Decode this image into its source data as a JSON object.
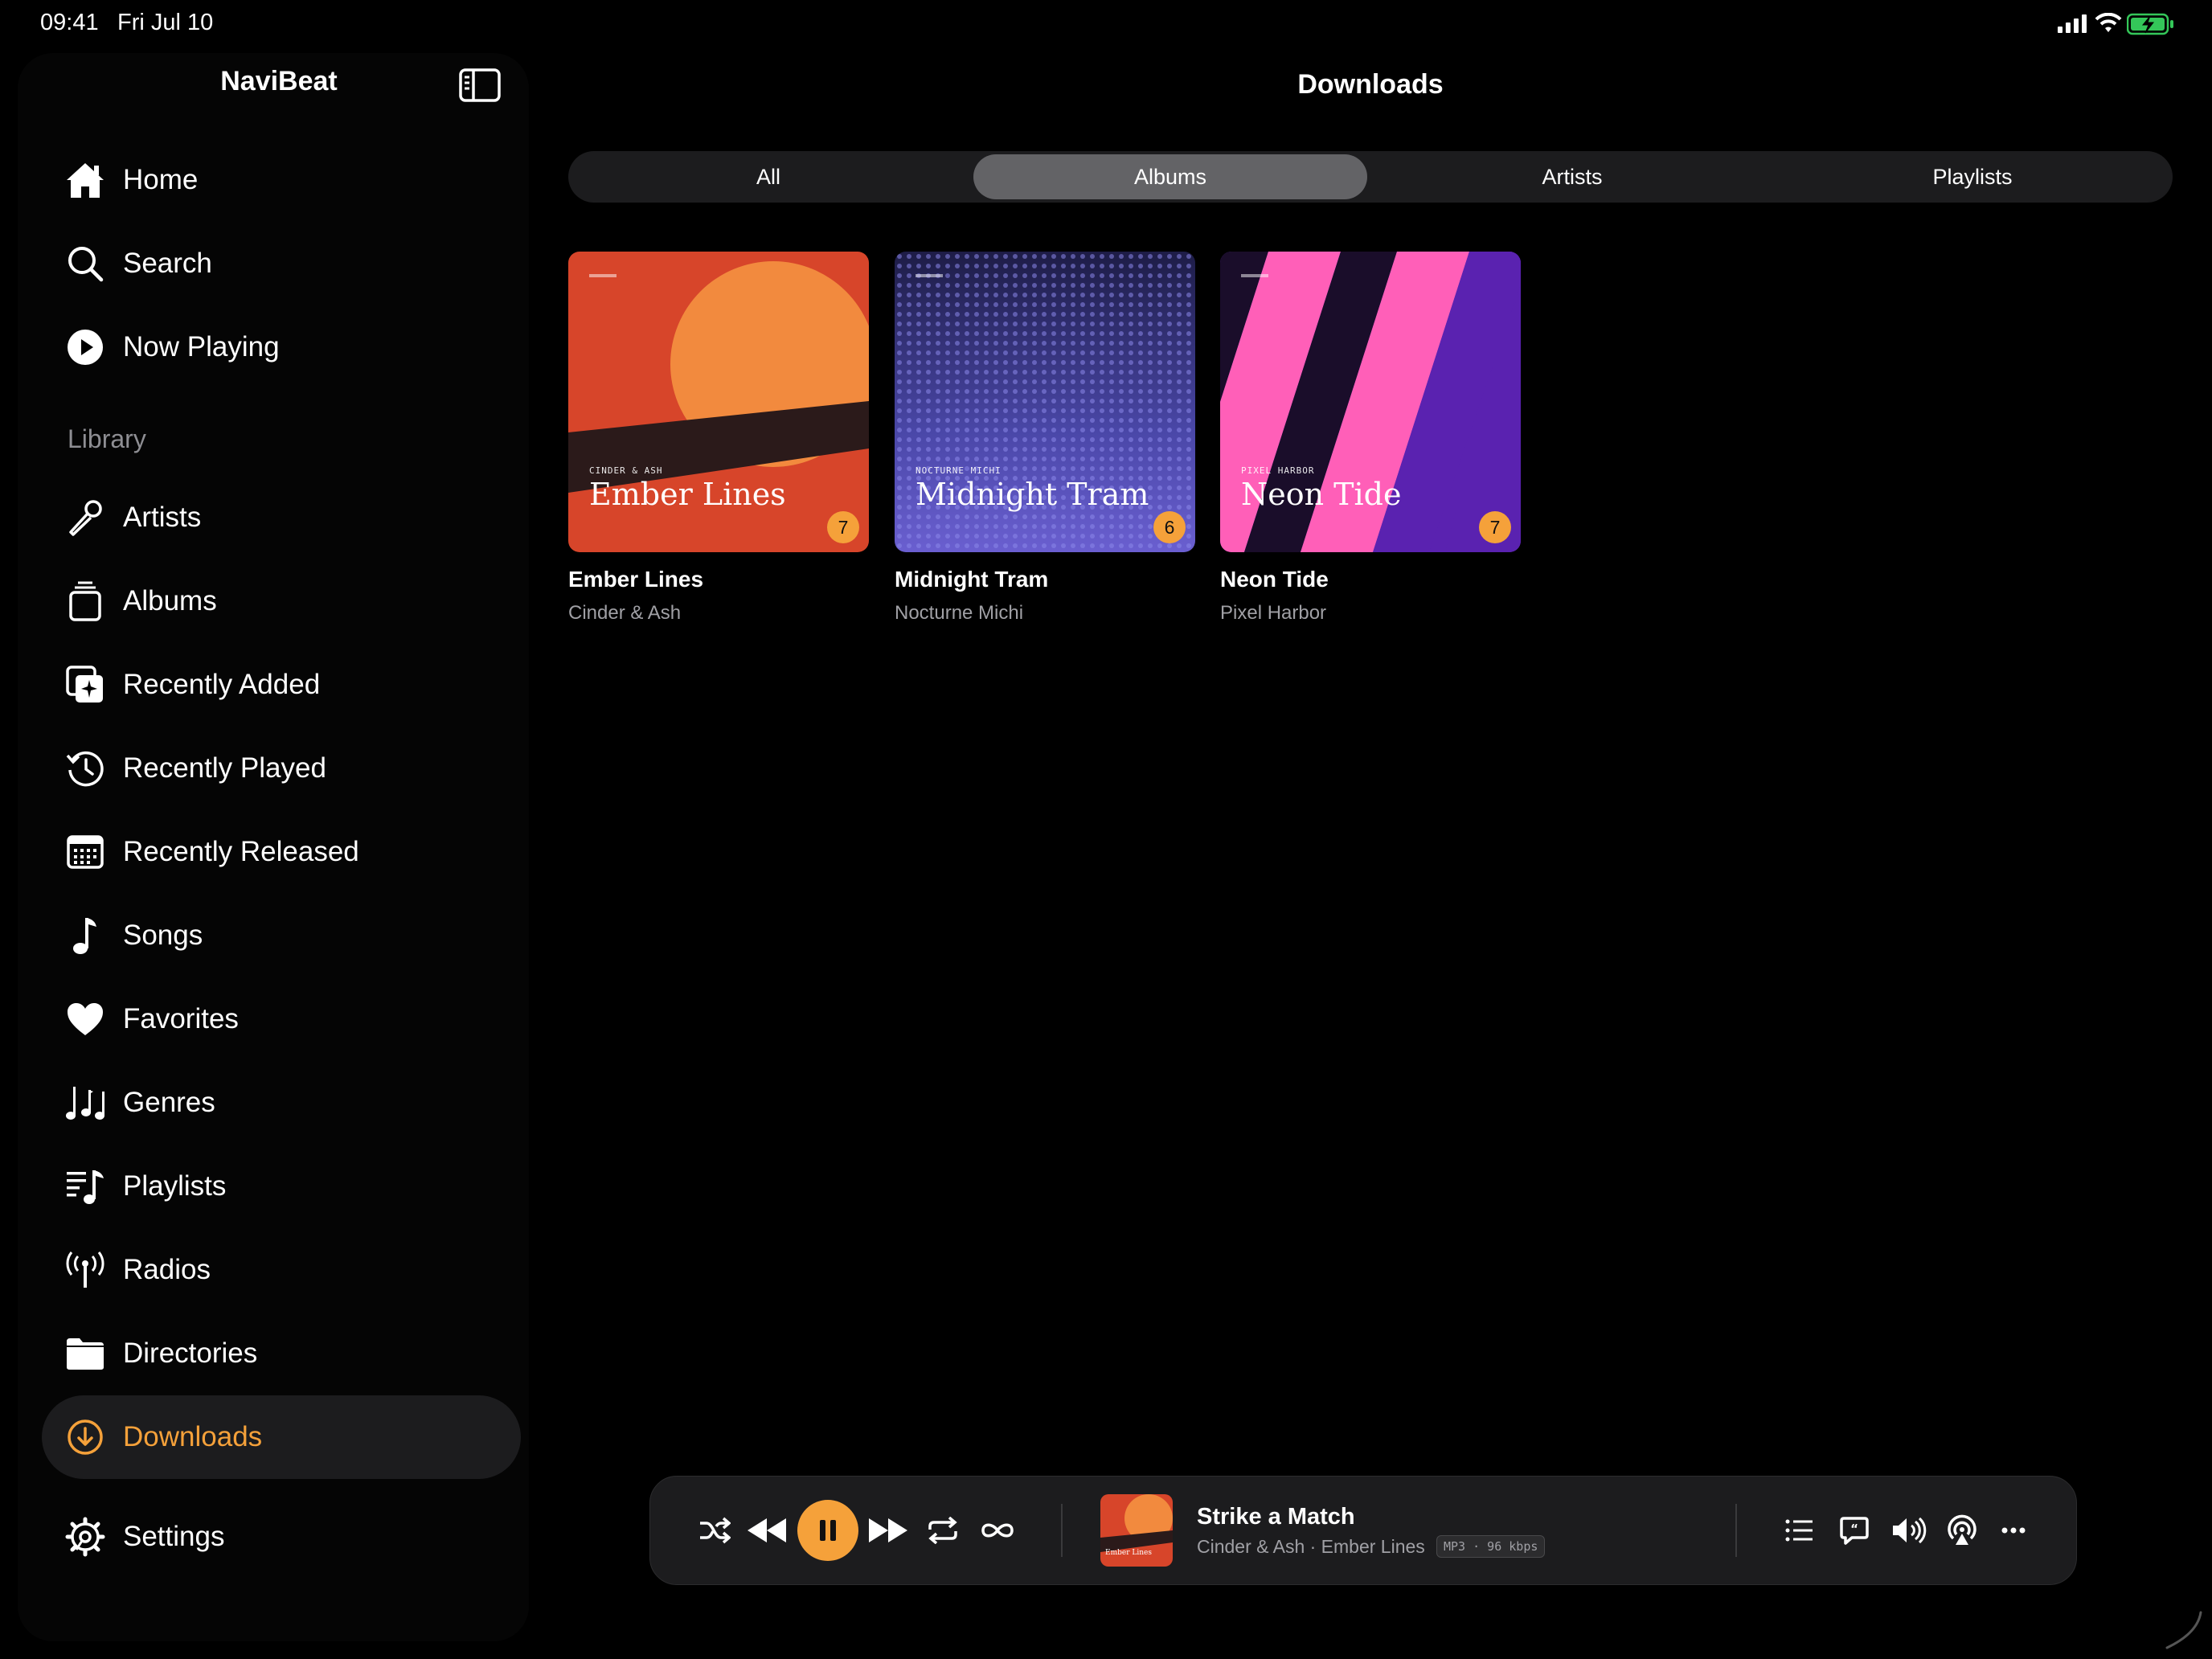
{
  "status": {
    "time": "09:41",
    "date": "Fri Jul 10"
  },
  "sidebar": {
    "app_title": "NaviBeat",
    "section_library": "Library",
    "items": [
      {
        "key": "home",
        "label": "Home",
        "icon": "house-icon"
      },
      {
        "key": "search",
        "label": "Search",
        "icon": "magnifier-icon"
      },
      {
        "key": "now-playing",
        "label": "Now Playing",
        "icon": "play-circle-icon"
      },
      {
        "key": "artists",
        "label": "Artists",
        "icon": "microphone-icon"
      },
      {
        "key": "albums",
        "label": "Albums",
        "icon": "album-stack-icon"
      },
      {
        "key": "recently-added",
        "label": "Recently Added",
        "icon": "add-star-icon"
      },
      {
        "key": "recently-played",
        "label": "Recently Played",
        "icon": "history-clock-icon"
      },
      {
        "key": "recently-released",
        "label": "Recently Released",
        "icon": "calendar-icon"
      },
      {
        "key": "songs",
        "label": "Songs",
        "icon": "music-note-icon"
      },
      {
        "key": "favorites",
        "label": "Favorites",
        "icon": "heart-icon"
      },
      {
        "key": "genres",
        "label": "Genres",
        "icon": "music-notes-icon"
      },
      {
        "key": "playlists",
        "label": "Playlists",
        "icon": "playlist-icon"
      },
      {
        "key": "radios",
        "label": "Radios",
        "icon": "antenna-icon"
      },
      {
        "key": "directories",
        "label": "Directories",
        "icon": "folder-icon"
      },
      {
        "key": "downloads",
        "label": "Downloads",
        "icon": "download-circle-icon",
        "active": true
      },
      {
        "key": "settings",
        "label": "Settings",
        "icon": "gear-icon"
      }
    ]
  },
  "main": {
    "title": "Downloads",
    "tabs": [
      {
        "label": "All"
      },
      {
        "label": "Albums",
        "active": true
      },
      {
        "label": "Artists"
      },
      {
        "label": "Playlists"
      }
    ],
    "albums": [
      {
        "title": "Ember Lines",
        "artist": "Cinder & Ash",
        "count": "7",
        "cover_artist": "CINDER & ASH",
        "cover_title": "Ember Lines"
      },
      {
        "title": "Midnight Tram",
        "artist": "Nocturne Michi",
        "count": "6",
        "cover_artist": "NOCTURNE MICHI",
        "cover_title": "Midnight Tram"
      },
      {
        "title": "Neon Tide",
        "artist": "Pixel Harbor",
        "count": "7",
        "cover_artist": "PIXEL HARBOR",
        "cover_title": "Neon Tide"
      }
    ]
  },
  "player": {
    "track": "Strike a Match",
    "subtitle": "Cinder & Ash · Ember Lines",
    "format": "MP3 · 96 kbps",
    "thumb_caption": "Ember Lines",
    "accent": "#f5a13a"
  }
}
